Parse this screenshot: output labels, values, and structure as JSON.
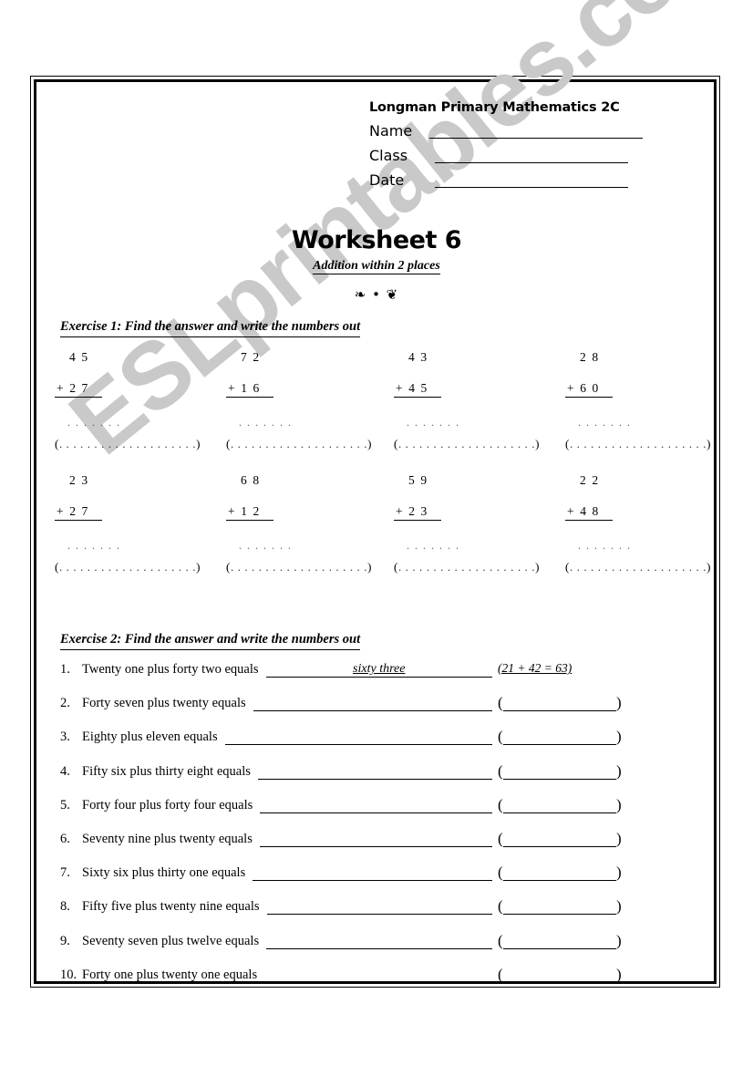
{
  "document": {
    "book_title": "Longman Primary Mathematics 2C",
    "worksheet_title": "Worksheet 6",
    "worksheet_subtitle": "Addition within 2 places",
    "ornament": "❧ • ❦",
    "watermark": "ESLprintables.com"
  },
  "header_fields": [
    {
      "label": "Name"
    },
    {
      "label": "Class"
    },
    {
      "label": "Date"
    }
  ],
  "exercise1": {
    "heading": "Exercise 1: Find the answer and write the numbers out",
    "answer_dots": ". . . . . . .",
    "words_paren_open": "(",
    "words_paren_dots": ". . . . . . . . . . . . . . . . . . . .",
    "words_paren_close": ")",
    "rows": [
      [
        {
          "top": "4 5",
          "bottom": "+ 2 7"
        },
        {
          "top": "7 2",
          "bottom": "+  1 6"
        },
        {
          "top": "4 3",
          "bottom": "+  4 5"
        },
        {
          "top": "2 8",
          "bottom": "+ 6 0"
        }
      ],
      [
        {
          "top": "2 3",
          "bottom": "+ 2 7"
        },
        {
          "top": "6 8",
          "bottom": "+  1 2"
        },
        {
          "top": "5 9",
          "bottom": "+  2 3"
        },
        {
          "top": "2 2",
          "bottom": "+ 4 8"
        }
      ]
    ]
  },
  "exercise2": {
    "heading": "Exercise 2: Find the answer and write the numbers out",
    "items": [
      {
        "num": "1.",
        "text": "Twenty one plus forty two equals",
        "answer": "sixty three",
        "working": "(21 + 42 = 63)"
      },
      {
        "num": "2.",
        "text": "Forty seven plus twenty equals",
        "answer": "",
        "working": ""
      },
      {
        "num": "3.",
        "text": "Eighty plus eleven equals",
        "answer": "",
        "working": ""
      },
      {
        "num": "4.",
        "text": "Fifty six plus thirty eight equals",
        "answer": "",
        "working": ""
      },
      {
        "num": "5.",
        "text": "Forty four plus forty four equals",
        "answer": "",
        "working": ""
      },
      {
        "num": "6.",
        "text": "Seventy nine plus twenty equals",
        "answer": "",
        "working": ""
      },
      {
        "num": "7.",
        "text": "Sixty six plus thirty one equals",
        "answer": "",
        "working": ""
      },
      {
        "num": "8.",
        "text": "Fifty five plus twenty nine equals",
        "answer": "",
        "working": ""
      },
      {
        "num": "9.",
        "text": "Seventy seven plus twelve equals",
        "answer": "",
        "working": ""
      },
      {
        "num": "10.",
        "text": "Forty one plus twenty one equals",
        "answer": "",
        "working": ""
      }
    ]
  }
}
